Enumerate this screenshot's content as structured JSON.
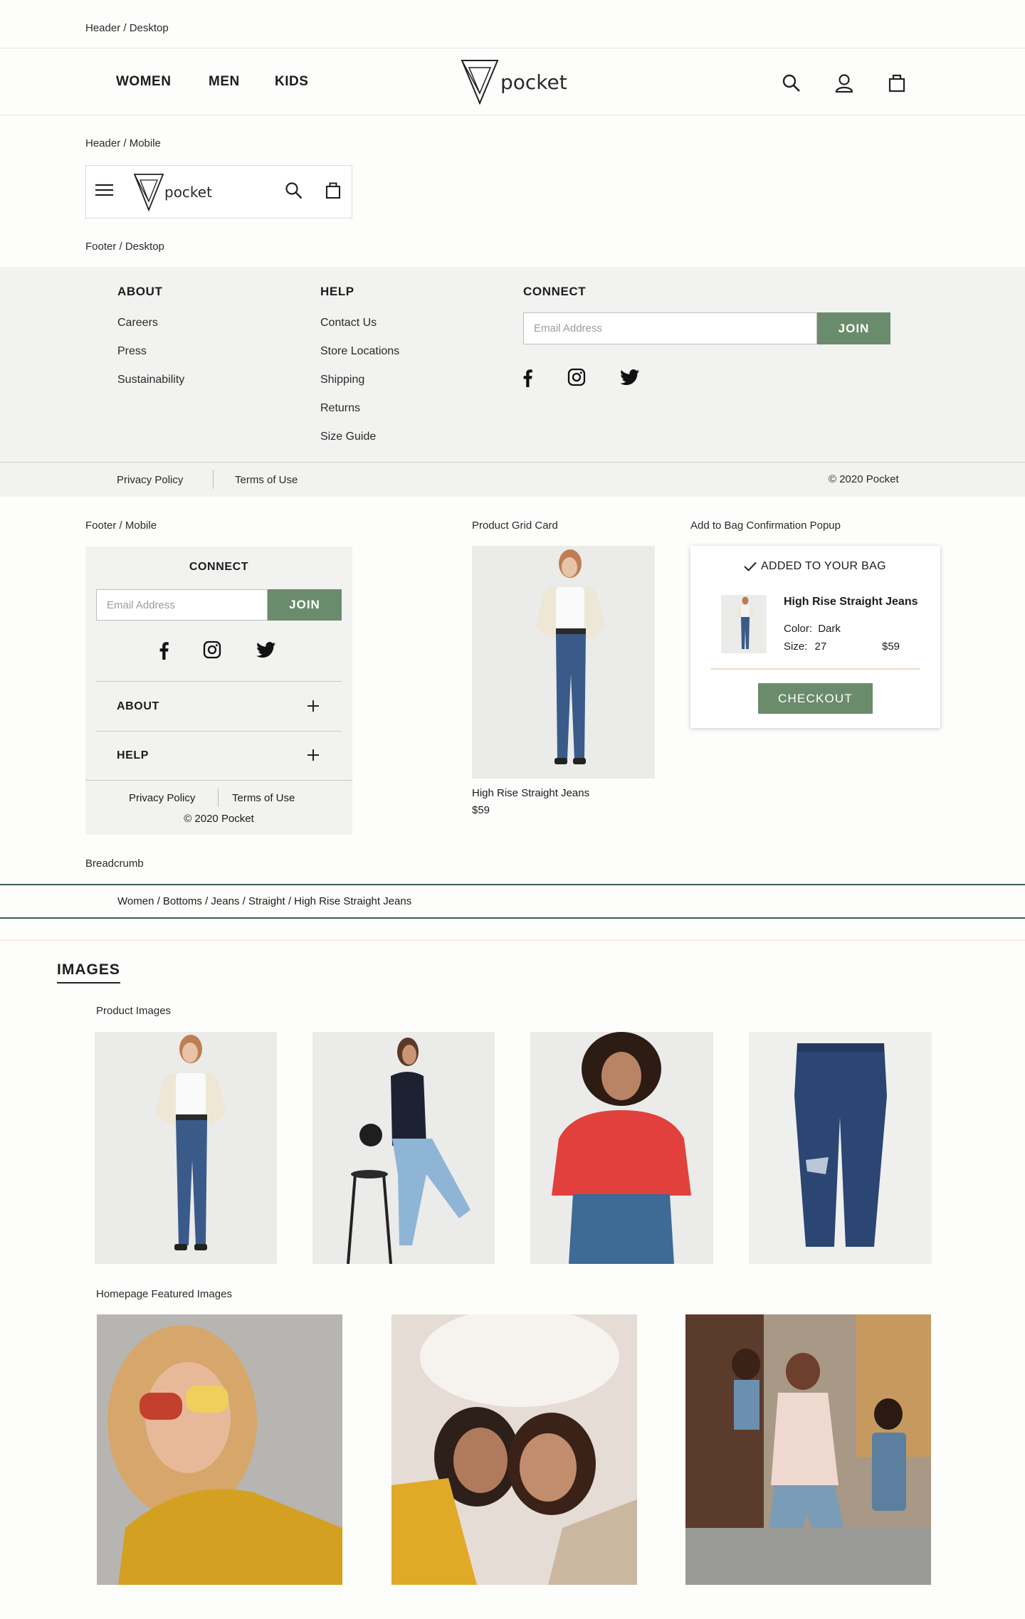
{
  "labels": {
    "header_desktop": "Header / Desktop",
    "header_mobile": "Header / Mobile",
    "footer_desktop": "Footer / Desktop",
    "footer_mobile": "Footer / Mobile",
    "product_grid_card": "Product Grid Card",
    "add_to_bag_popup": "Add to Bag Confirmation Popup",
    "breadcrumb": "Breadcrumb",
    "product_images": "Product Images",
    "featured_images": "Homepage Featured Images"
  },
  "header": {
    "nav": [
      "WOMEN",
      "MEN",
      "KIDS"
    ],
    "logo_text": "pocket",
    "icons": [
      "search-icon",
      "user-icon",
      "bag-icon"
    ]
  },
  "footer": {
    "about_heading": "ABOUT",
    "about_links": [
      "Careers",
      "Press",
      "Sustainability"
    ],
    "help_heading": "HELP",
    "help_links": [
      "Contact Us",
      "Store Locations",
      "Shipping",
      "Returns",
      "Size Guide"
    ],
    "connect_heading": "CONNECT",
    "email_placeholder": "Email Address",
    "join_label": "JOIN",
    "social_icons": [
      "facebook-icon",
      "instagram-icon",
      "twitter-icon"
    ],
    "privacy": "Privacy Policy",
    "terms": "Terms of Use",
    "copyright": "© 2020 Pocket"
  },
  "product_card": {
    "name": "High Rise Straight Jeans",
    "price": "$59"
  },
  "popup": {
    "title": "ADDED TO YOUR BAG",
    "product_name": "High Rise Straight Jeans",
    "color_label": "Color:",
    "color_value": "Dark",
    "size_label": "Size:",
    "size_value": "27",
    "price": "$59",
    "checkout_label": "CHECKOUT"
  },
  "breadcrumb": {
    "items": [
      "Women",
      "Bottoms",
      "Jeans",
      "Straight",
      "High Rise Straight Jeans"
    ],
    "text": "Women / Bottoms / Jeans / Straight / High Rise Straight Jeans"
  },
  "images_section": {
    "heading": "IMAGES"
  },
  "colors": {
    "accent_green": "#6b8c6c",
    "footer_bg": "#f2f2f1",
    "breadcrumb_line": "#3f5c52"
  }
}
